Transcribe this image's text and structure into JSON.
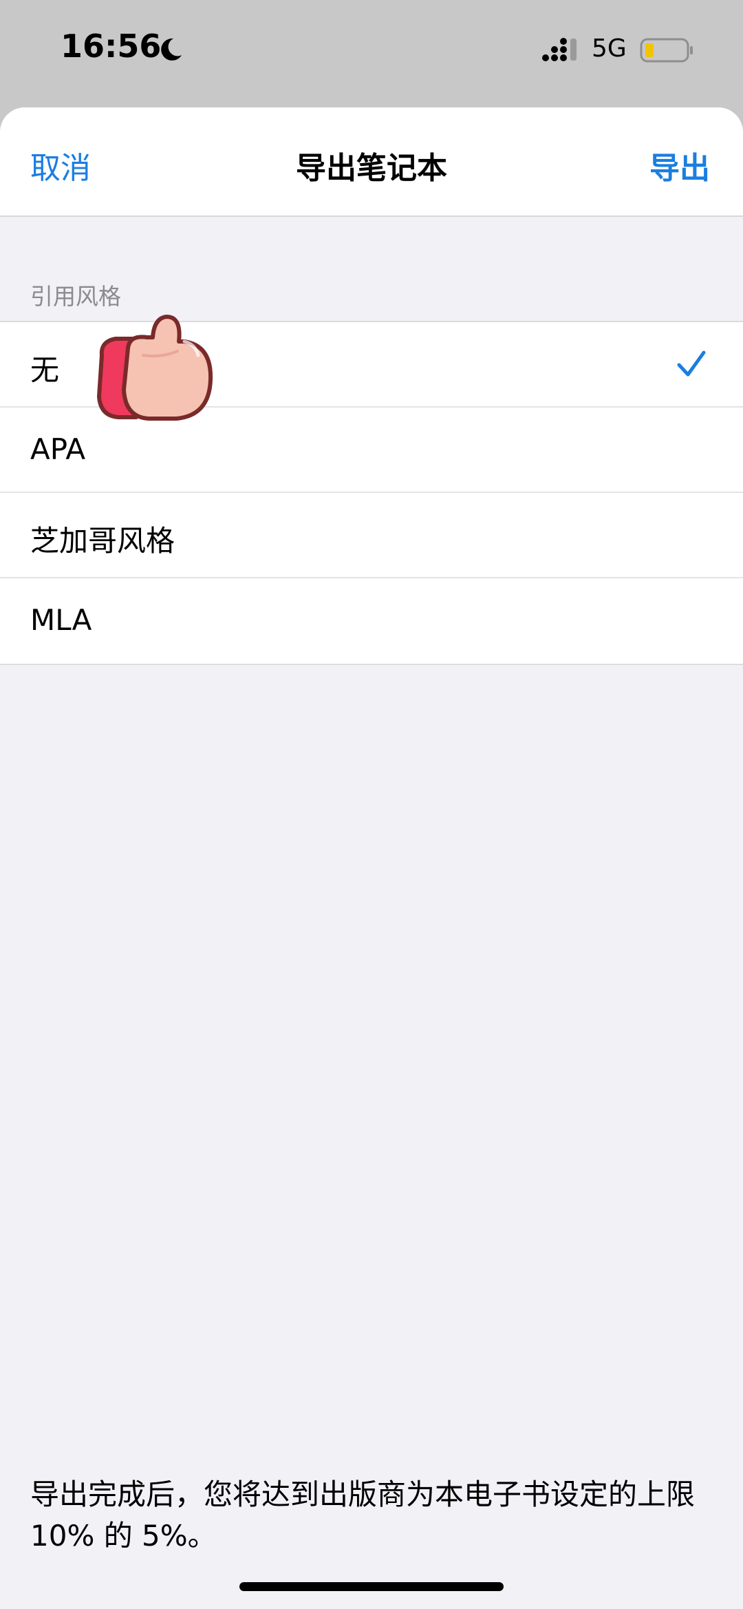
{
  "status_bar": {
    "time": "16:56",
    "network": "5G",
    "icons": [
      "moon-icon",
      "signal-icon",
      "battery-icon"
    ]
  },
  "nav": {
    "cancel_label": "取消",
    "title": "导出笔记本",
    "export_label": "导出"
  },
  "section": {
    "header": "引用风格",
    "items": [
      {
        "label": "无",
        "selected": true
      },
      {
        "label": "APA",
        "selected": false
      },
      {
        "label": "芝加哥风格",
        "selected": false
      },
      {
        "label": "MLA",
        "selected": false
      }
    ]
  },
  "footer": {
    "note": "导出完成后，您将达到出版商为本电子书设定的上限 10% 的 5%。"
  },
  "colors": {
    "accent": "#1a7ee0",
    "background": "#f1f1f6",
    "battery_level": "#f2c400"
  }
}
